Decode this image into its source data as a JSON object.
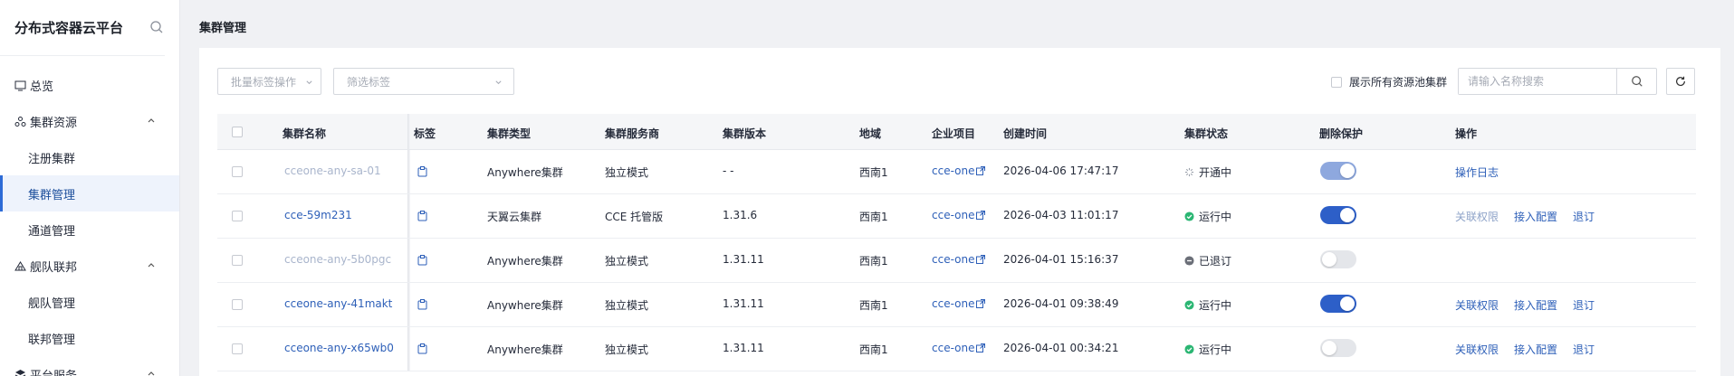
{
  "sidebar": {
    "title": "分布式容器云平台",
    "items": [
      {
        "label": "总览",
        "icon": "overview-icon",
        "type": "top"
      },
      {
        "label": "集群资源",
        "icon": "cluster-resource-icon",
        "type": "group"
      },
      {
        "label": "注册集群",
        "type": "sub"
      },
      {
        "label": "集群管理",
        "type": "sub",
        "active": true
      },
      {
        "label": "通道管理",
        "type": "sub"
      },
      {
        "label": "舰队联邦",
        "icon": "fleet-icon",
        "type": "group"
      },
      {
        "label": "舰队管理",
        "type": "sub"
      },
      {
        "label": "联邦管理",
        "type": "sub"
      },
      {
        "label": "平台服务",
        "icon": "platform-service-icon",
        "type": "group"
      }
    ]
  },
  "page": {
    "title": "集群管理"
  },
  "toolbar": {
    "batch_tag_label": "批量标签操作",
    "filter_tag_placeholder": "筛选标签",
    "show_all_label": "展示所有资源池集群",
    "search_placeholder": "请输入名称搜索"
  },
  "table": {
    "headers": {
      "name": "集群名称",
      "tag": "标签",
      "type": "集群类型",
      "provider": "集群服务商",
      "version": "集群版本",
      "region": "地域",
      "enterprise": "企业项目",
      "created": "创建时间",
      "status": "集群状态",
      "protect": "删除保护",
      "ops": "操作"
    },
    "rows": [
      {
        "name": "cceone-any-sa-01",
        "name_style": "muted",
        "type": "Anywhere集群",
        "provider": "独立模式",
        "version": "- -",
        "region": "西南1",
        "enterprise": "cce-one",
        "created": "2026-04-06 17:47:17",
        "status": "开通中",
        "status_kind": "pending",
        "protect": "on-muted",
        "ops": [
          "操作日志"
        ]
      },
      {
        "name": "cce-59m231",
        "name_style": "link",
        "type": "天翼云集群",
        "provider": "CCE 托管版",
        "version": "1.31.6",
        "region": "西南1",
        "enterprise": "cce-one",
        "created": "2026-04-03 11:01:17",
        "status": "运行中",
        "status_kind": "running",
        "protect": "on",
        "ops": [
          "关联权限",
          "接入配置",
          "退订"
        ],
        "ops_first_muted": true
      },
      {
        "name": "cceone-any-5b0pgc",
        "name_style": "muted",
        "type": "Anywhere集群",
        "provider": "独立模式",
        "version": "1.31.11",
        "region": "西南1",
        "enterprise": "cce-one",
        "created": "2026-04-01 15:16:37",
        "status": "已退订",
        "status_kind": "cancelled",
        "protect": "off",
        "ops": []
      },
      {
        "name": "cceone-any-41makt",
        "name_style": "link",
        "type": "Anywhere集群",
        "provider": "独立模式",
        "version": "1.31.11",
        "region": "西南1",
        "enterprise": "cce-one",
        "created": "2026-04-01 09:38:49",
        "status": "运行中",
        "status_kind": "running",
        "protect": "on",
        "ops": [
          "关联权限",
          "接入配置",
          "退订"
        ]
      },
      {
        "name": "cceone-any-x65wb0",
        "name_style": "link",
        "type": "Anywhere集群",
        "provider": "独立模式",
        "version": "1.31.11",
        "region": "西南1",
        "enterprise": "cce-one",
        "created": "2026-04-01 00:34:21",
        "status": "运行中",
        "status_kind": "running",
        "protect": "off",
        "ops": [
          "关联权限",
          "接入配置",
          "退订"
        ]
      }
    ]
  },
  "colors": {
    "accent": "#2d5fb8",
    "running": "#2bb673",
    "cancelled": "#6b6f78",
    "toggle_on": "#2d5fc8"
  }
}
